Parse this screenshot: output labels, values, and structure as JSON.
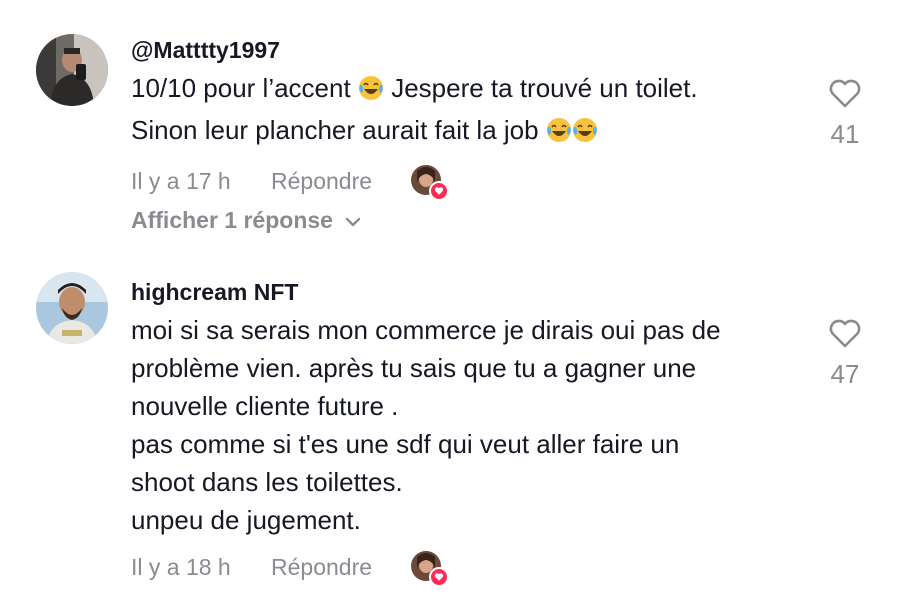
{
  "comments": [
    {
      "username": "@Matttty1997",
      "lines": [
        "10/10 pour l’accent",
        "Jespere ta trouvé un toilet.",
        "Sinon leur plancher aurait fait la job"
      ],
      "time": "Il y a 17 h",
      "reply_label": "Répondre",
      "like_count": "41",
      "show_replies_label": "Afficher 1 réponse"
    },
    {
      "username": "highcream NFT",
      "lines": [
        "moi si sa serais mon commerce je dirais oui pas de",
        "problème vien. après tu sais que tu a gagner une",
        "nouvelle cliente future .",
        "pas comme si t'es une sdf qui veut aller faire un",
        "shoot dans les toilettes.",
        "unpeu de jugement."
      ],
      "time": "Il y a 18 h",
      "reply_label": "Répondre",
      "like_count": "47"
    }
  ],
  "icons": {
    "like": "heart-outline-icon",
    "emoji": "face-with-tears-of-joy",
    "chevron": "chevron-down-icon",
    "creator_like": "creator-liked-badge"
  },
  "colors": {
    "text": "#161823",
    "muted": "#8a8b91",
    "accent": "#fe2c55"
  }
}
